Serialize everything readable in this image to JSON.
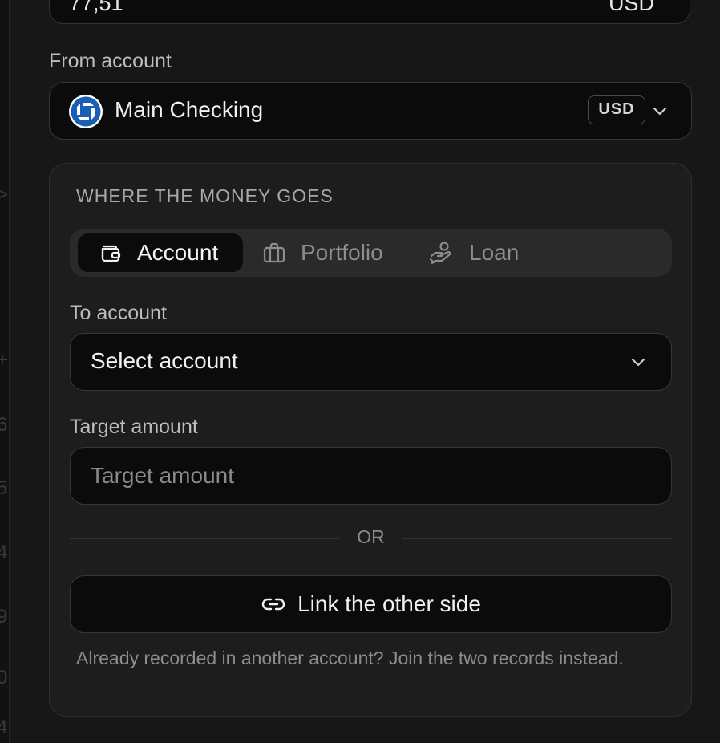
{
  "amount_field": {
    "value": "77,51",
    "currency": "USD"
  },
  "from_account": {
    "label": "From account",
    "name": "Main Checking",
    "currency_badge": "USD",
    "icon": "bank-logo-icon",
    "icon_color": "#1a5fb4"
  },
  "destination": {
    "heading": "WHERE THE MONEY GOES",
    "tabs": [
      {
        "label": "Account",
        "icon": "wallet-icon",
        "active": true
      },
      {
        "label": "Portfolio",
        "icon": "briefcase-icon",
        "active": false
      },
      {
        "label": "Loan",
        "icon": "hand-coin-icon",
        "active": false
      }
    ],
    "to_account": {
      "label": "To account",
      "value": "Select account"
    },
    "target_amount": {
      "label": "Target amount",
      "placeholder": "Target amount"
    },
    "divider_text": "OR",
    "link_button": {
      "label": "Link the other side",
      "icon": "link-icon"
    },
    "helper_text": "Already recorded in another account? Join the two records instead."
  },
  "left_strip_fragments": [
    ">",
    "+",
    "6",
    "5",
    "4",
    "9",
    "0",
    "4"
  ]
}
